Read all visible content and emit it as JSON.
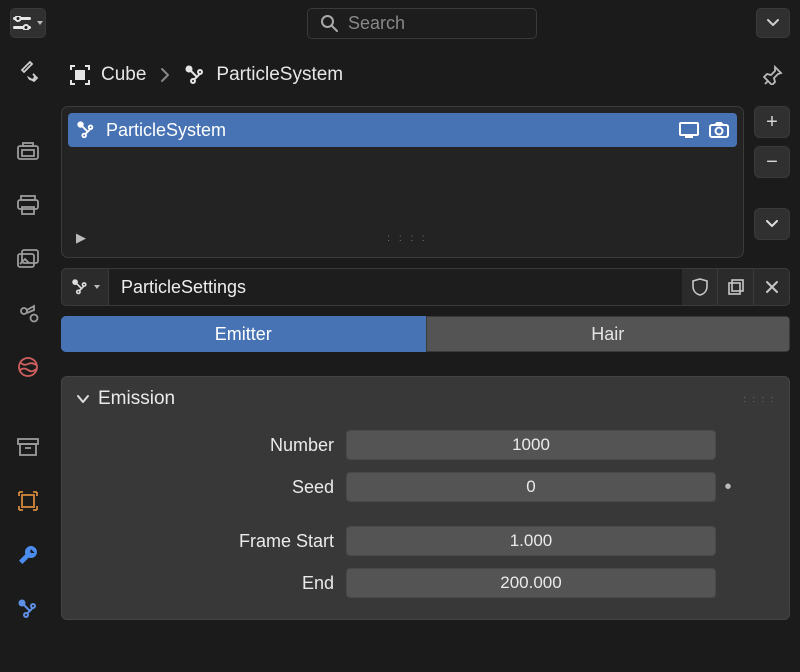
{
  "search": {
    "placeholder": "Search"
  },
  "breadcrumb": {
    "object": "Cube",
    "system": "ParticleSystem"
  },
  "list": {
    "active": "ParticleSystem"
  },
  "datablock": {
    "name": "ParticleSettings"
  },
  "type_tabs": {
    "emitter": "Emitter",
    "hair": "Hair"
  },
  "panel": {
    "title": "Emission",
    "fields": {
      "number": {
        "label": "Number",
        "value": "1000"
      },
      "seed": {
        "label": "Seed",
        "value": "0"
      },
      "frame_start": {
        "label": "Frame Start",
        "value": "1.000"
      },
      "frame_end": {
        "label": "End",
        "value": "200.000"
      }
    }
  }
}
